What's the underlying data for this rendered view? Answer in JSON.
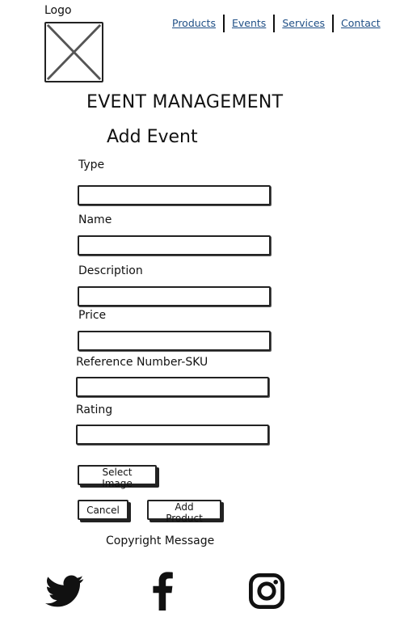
{
  "header": {
    "logo_label": "Logo",
    "nav": [
      "Products",
      "Events",
      "Services",
      "Contact"
    ]
  },
  "page_title": "EVENT MANAGEMENT",
  "form": {
    "heading": "Add Event",
    "fields": [
      {
        "label": "Type",
        "value": ""
      },
      {
        "label": "Name",
        "value": ""
      },
      {
        "label": "Description",
        "value": ""
      },
      {
        "label": "Price",
        "value": ""
      },
      {
        "label": "Reference Number-SKU",
        "value": ""
      },
      {
        "label": "Rating",
        "value": ""
      }
    ],
    "select_image_label": "Select Image",
    "cancel_label": "Cancel",
    "add_label": "Add Product"
  },
  "footer": {
    "copyright": "Copyright Message",
    "social_icons": [
      "twitter-icon",
      "facebook-icon",
      "instagram-icon"
    ]
  },
  "colors": {
    "link": "#1f4f86",
    "ink": "#111111"
  }
}
